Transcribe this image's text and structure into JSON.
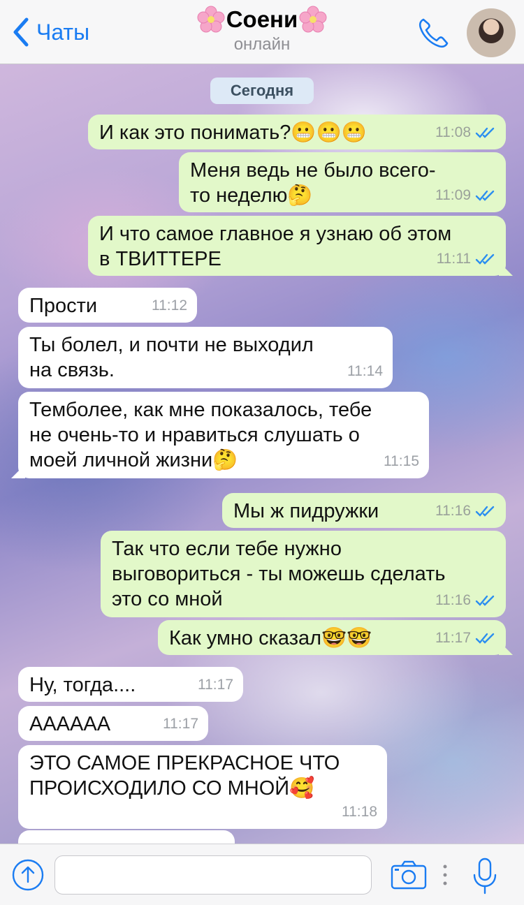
{
  "header": {
    "back_label": "Чаты",
    "title": "Соени",
    "status": "онлайн"
  },
  "chat": {
    "date_label": "Сегодня",
    "messages": [
      {
        "dir": "out",
        "text": "И как это понимать?😬😬😬",
        "time": "11:08"
      },
      {
        "dir": "out",
        "text": "Меня ведь не было всего-\nто неделю🤔",
        "time": "11:09"
      },
      {
        "dir": "out",
        "text": "И что самое главное я узнаю об этом\nв ТВИТТЕРЕ",
        "time": "11:11"
      },
      {
        "dir": "in",
        "text": "Прости",
        "time": "11:12"
      },
      {
        "dir": "in",
        "text": "Ты болел, и почти не выходил\nна связь.",
        "time": "11:14"
      },
      {
        "dir": "in",
        "text": "Темболее, как мне показалось, тебе\nне очень-то и нравиться слушать о\nмоей личной жизни🤔",
        "time": "11:15"
      },
      {
        "dir": "out",
        "text": "Мы ж пидружки",
        "time": "11:16"
      },
      {
        "dir": "out",
        "text": "Так что если тебе нужно\nвыговориться - ты можешь сделать\nэто со мной",
        "time": "11:16"
      },
      {
        "dir": "out",
        "text": "Как умно сказал🤓🤓",
        "time": "11:17"
      },
      {
        "dir": "in",
        "text": "Ну, тогда....",
        "time": "11:17"
      },
      {
        "dir": "in",
        "text": "АААААА",
        "time": "11:17"
      },
      {
        "dir": "in",
        "text": "ЭТО САМОЕ ПРЕКРАСНОЕ ЧТО\nПРОИСХОДИЛО СО МНОЙ🥰",
        "time": "11:18"
      },
      {
        "dir": "in",
        "text": "",
        "time": ""
      }
    ]
  },
  "input": {
    "value": "",
    "placeholder": ""
  },
  "colors": {
    "accent": "#1a7cf2",
    "outgoing_bubble": "#e2f8c9",
    "incoming_bubble": "#ffffff",
    "date_pill": "#dde9f6",
    "ticks": "#2b8ef0"
  },
  "icons": [
    "chevron-left-icon",
    "flower-icon",
    "phone-icon",
    "avatar",
    "double-check-icon",
    "upload-arrow-icon",
    "camera-icon",
    "mic-icon"
  ]
}
